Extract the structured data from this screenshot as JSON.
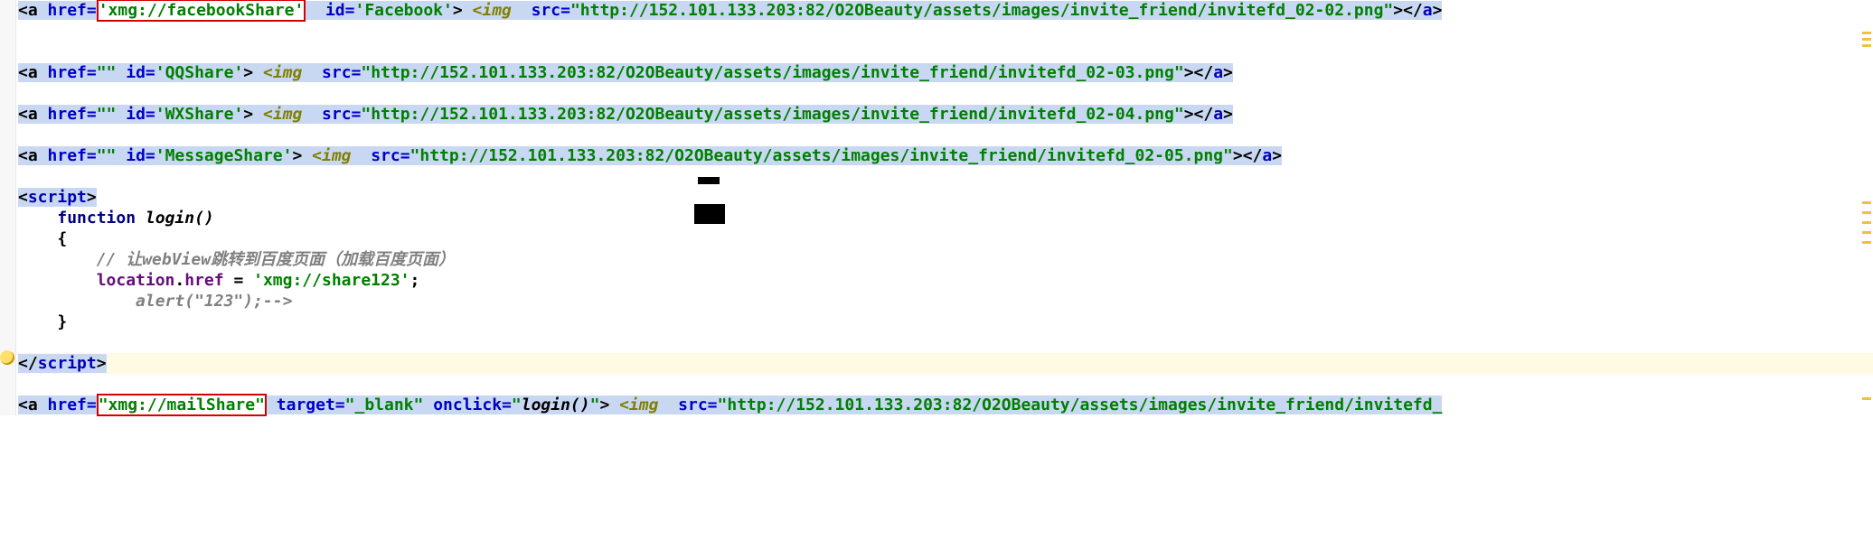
{
  "lines": {
    "l1": {
      "a_open": "<a ",
      "href_attr": "href=",
      "href_val": "'xmg://facebookShare'",
      "space1": "  ",
      "id_attr": "id=",
      "id_val": "'Facebook'",
      "close_a": "> ",
      "img_open": "<img  ",
      "src_attr": "src=",
      "src_val": "\"http://152.101.133.203:82/O2OBeauty/assets/images/invite_friend/invitefd_02-02.png\"",
      "img_end": "></",
      "a_end_tag": "a",
      "a_end": ">"
    },
    "l2": {
      "a_open": "<a ",
      "href_attr": "href=",
      "href_val": "\"\"",
      "space1": " ",
      "id_attr": "id=",
      "id_val": "'QQShare'",
      "close_a": "> ",
      "img_open": "<img  ",
      "src_attr": "src=",
      "src_val": "\"http://152.101.133.203:82/O2OBeauty/assets/images/invite_friend/invitefd_02-03.png\"",
      "img_end": "></",
      "a_end_tag": "a",
      "a_end": ">"
    },
    "l3": {
      "a_open": "<a ",
      "href_attr": "href=",
      "href_val": "\"\"",
      "space1": " ",
      "id_attr": "id=",
      "id_val": "'WXShare'",
      "close_a": "> ",
      "img_open": "<img  ",
      "src_attr": "src=",
      "src_val": "\"http://152.101.133.203:82/O2OBeauty/assets/images/invite_friend/invitefd_02-04.png\"",
      "img_end": "></",
      "a_end_tag": "a",
      "a_end": ">"
    },
    "l4": {
      "a_open": "<a ",
      "href_attr": "href=",
      "href_val": "\"\"",
      "space1": " ",
      "id_attr": "id=",
      "id_val": "'MessageShare'",
      "close_a": "> ",
      "img_open": "<img  ",
      "src_attr": "src=",
      "src_val": "\"http://152.101.133.203:82/O2OBeauty/assets/images/invite_friend/invitefd_02-05.png\"",
      "img_end": "></",
      "a_end_tag": "a",
      "a_end": ">"
    },
    "script_open": "<script>",
    "fn_kw": "function",
    "fn_name": " login()",
    "brace_open": "{",
    "comment": "// 让webView跳转到百度页面（加载百度页面）",
    "loc": "location",
    "dot": ".",
    "href_prop": "href",
    "assign": " = ",
    "href_str": "'xmg://share123'",
    "semi": ";",
    "alert_cmt": "alert(\"123\");-->",
    "brace_close": "}",
    "script_close_pre": "</",
    "script_close_tag": "script",
    "script_close_post": ">",
    "l5": {
      "a_open": "<a ",
      "href_attr": "href=",
      "href_val": "\"xmg://mailShare\"",
      "space1": " ",
      "tgt_attr": "target=",
      "tgt_val": "\"_blank\"",
      "space2": " ",
      "onclick_attr": "onclick=",
      "onclick_val_pre": "\"",
      "onclick_fn": "login()",
      "onclick_val_post": "\"",
      "close_a": "> ",
      "img_open": "<img  ",
      "src_attr": "src=",
      "src_val": "\"http://152.101.133.203:82/O2OBeauty/assets/images/invite_friend/invitefd_"
    }
  },
  "marks": [
    35,
    42,
    49,
    223,
    234,
    245,
    256,
    267,
    440
  ]
}
